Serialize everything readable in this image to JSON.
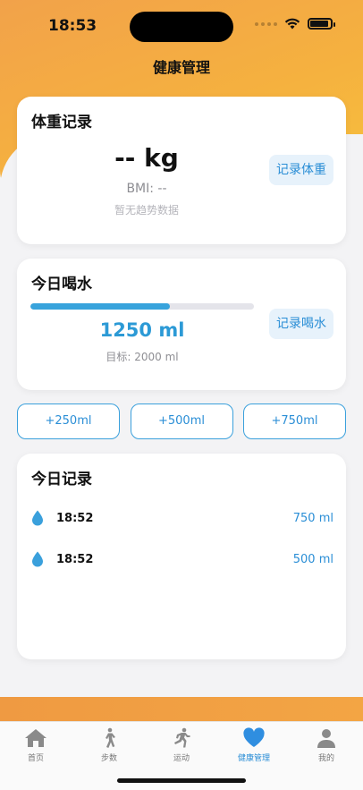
{
  "status_bar": {
    "time": "18:53"
  },
  "header": {
    "title": "健康管理"
  },
  "weight": {
    "title": "体重记录",
    "value": "-- kg",
    "bmi": "BMI: --",
    "trend": "暂无趋势数据",
    "record_button": "记录体重"
  },
  "water": {
    "title": "今日喝水",
    "progress_fraction": 0.625,
    "amount": "1250 ml",
    "goal": "目标: 2000 ml",
    "record_button": "记录喝水",
    "accent_color": "#38a3dc"
  },
  "quick_add": [
    "+250ml",
    "+500ml",
    "+750ml"
  ],
  "log": {
    "title": "今日记录",
    "entries": [
      {
        "icon": "water-drop-icon",
        "time": "18:52",
        "amount": "750 ml"
      },
      {
        "icon": "water-drop-icon",
        "time": "18:52",
        "amount": "500 ml"
      }
    ]
  },
  "tab_bar": {
    "items": [
      {
        "label": "首页",
        "icon": "home-icon"
      },
      {
        "label": "步数",
        "icon": "walking-icon"
      },
      {
        "label": "运动",
        "icon": "running-icon"
      },
      {
        "label": "健康管理",
        "icon": "heart-icon",
        "active": true
      },
      {
        "label": "我的",
        "icon": "person-icon"
      }
    ]
  }
}
